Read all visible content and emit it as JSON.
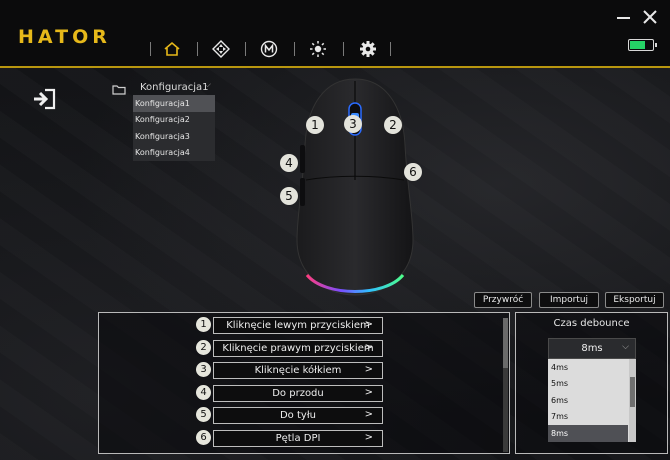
{
  "app": {
    "logo": "HATOR"
  },
  "nav": {
    "items": [
      {
        "name": "home",
        "icon": "home-icon",
        "active": true
      },
      {
        "name": "buttons",
        "icon": "dpad-icon"
      },
      {
        "name": "macro",
        "icon": "macro-m-icon"
      },
      {
        "name": "lighting",
        "icon": "sun-icon"
      },
      {
        "name": "settings",
        "icon": "gear-icon"
      }
    ]
  },
  "window": {
    "minimize_icon": "minimize-icon",
    "close_icon": "close-icon"
  },
  "battery": {
    "level": 0.7,
    "color": "#25d366"
  },
  "config": {
    "selected": "Konfiguracja1",
    "options": [
      "Konfiguracja1",
      "Konfiguracja2",
      "Konfiguracja3",
      "Konfiguracja4"
    ]
  },
  "mouse_badges": [
    "1",
    "3",
    "2",
    "4",
    "6",
    "5"
  ],
  "actions": {
    "reset": "Przywróć",
    "import": "Importuj",
    "export": "Eksportuj"
  },
  "button_mappings": [
    {
      "num": "1",
      "label": "Kliknęcie lewym przyciskiem",
      "arrow": ">"
    },
    {
      "num": "2",
      "label": "Kliknęcie prawym przyciskiem",
      "arrow": ">"
    },
    {
      "num": "3",
      "label": "Kliknęcie kółkiem",
      "arrow": ">"
    },
    {
      "num": "4",
      "label": "Do przodu",
      "arrow": ">"
    },
    {
      "num": "5",
      "label": "Do tyłu",
      "arrow": ">"
    },
    {
      "num": "6",
      "label": "Pętla DPI",
      "arrow": ">"
    }
  ],
  "debounce": {
    "title": "Czas debounce",
    "selected": "8ms",
    "options": [
      "4ms",
      "5ms",
      "6ms",
      "7ms",
      "8ms"
    ]
  },
  "colors": {
    "accent": "#e6b81a",
    "gold_line": "#b8960f"
  }
}
